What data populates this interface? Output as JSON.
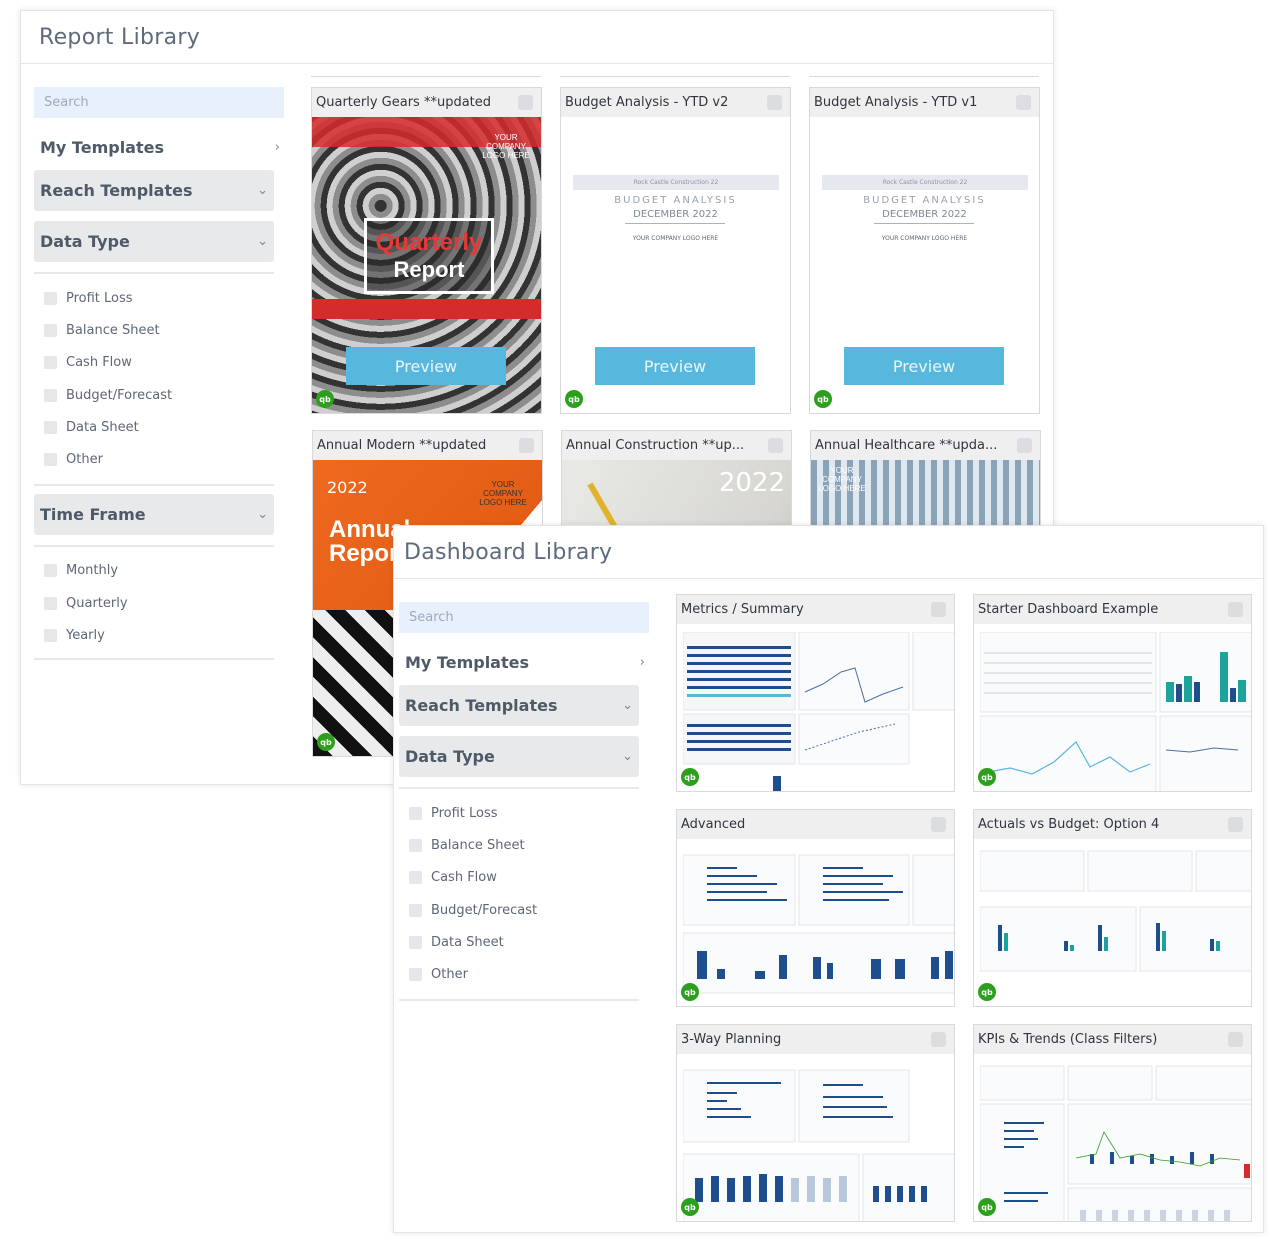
{
  "report_library": {
    "title": "Report Library",
    "search_placeholder": "Search",
    "my_templates": "My Templates",
    "reach_templates": "Reach Templates",
    "data_type": {
      "label": "Data Type",
      "options": [
        "Profit Loss",
        "Balance Sheet",
        "Cash Flow",
        "Budget/Forecast",
        "Data Sheet",
        "Other"
      ]
    },
    "time_frame": {
      "label": "Time Frame",
      "options": [
        "Monthly",
        "Quarterly",
        "Yearly"
      ]
    },
    "cards": [
      {
        "title": "Quarterly Gears **updated",
        "preview": "Preview",
        "logo": "YOUR COMPANY LOGO HERE",
        "cover_title_1": "Quarterly",
        "cover_title_2": "Report"
      },
      {
        "title": "Budget Analysis - YTD v2",
        "preview": "Preview",
        "company": "Rock Castle Construction 22",
        "cover_title": "BUDGET ANALYSIS",
        "date": "DECEMBER 2022",
        "logo": "YOUR COMPANY LOGO HERE"
      },
      {
        "title": "Budget Analysis - YTD v1",
        "preview": "Preview",
        "company": "Rock Castle Construction 22",
        "cover_title": "BUDGET ANALYSIS",
        "date": "DECEMBER 2022",
        "logo": "YOUR COMPANY LOGO HERE"
      },
      {
        "title": "Annual Modern **updated",
        "year": "2022",
        "cover_title_1": "Annual",
        "cover_title_2": "Report",
        "logo": "YOUR COMPANY LOGO HERE"
      },
      {
        "title": "Annual Construction **up...",
        "year": "2022"
      },
      {
        "title": "Annual Healthcare **upda...",
        "logo": "YOUR COMPANY LOGO HERE"
      }
    ],
    "qb_badge": "qb"
  },
  "dashboard_library": {
    "title": "Dashboard Library",
    "search_placeholder": "Search",
    "my_templates": "My Templates",
    "reach_templates": "Reach Templates",
    "data_type": {
      "label": "Data Type",
      "options": [
        "Profit Loss",
        "Balance Sheet",
        "Cash Flow",
        "Budget/Forecast",
        "Data Sheet",
        "Other"
      ]
    },
    "cards": [
      {
        "title": "Metrics / Summary"
      },
      {
        "title": "Starter Dashboard Example"
      },
      {
        "title": "Advanced"
      },
      {
        "title": "Actuals vs Budget: Option 4"
      },
      {
        "title": "3-Way Planning"
      },
      {
        "title": "KPIs & Trends (Class Filters)"
      }
    ],
    "qb_badge": "qb"
  },
  "colors": {
    "preview_button": "#58b7dc",
    "quickbooks_green": "#2ca01c",
    "search_bg": "#e8f0fb",
    "section_head_bg": "#e8e9eb",
    "chart_navy": "#1f4e8c",
    "chart_teal": "#1ba39c"
  }
}
